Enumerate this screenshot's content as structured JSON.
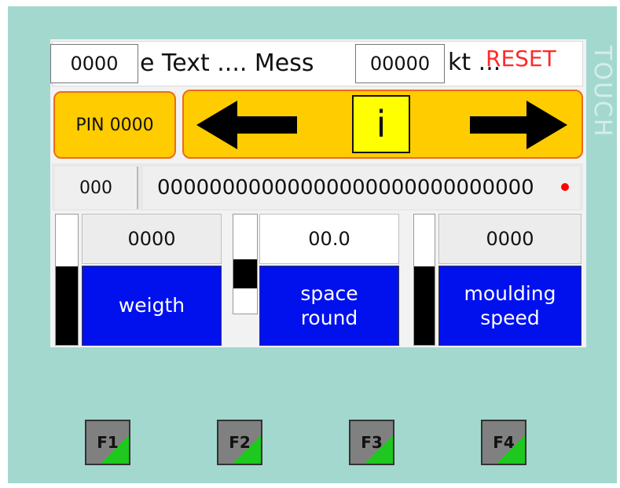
{
  "message_bar": {
    "counter_left": "0000",
    "scroll_text": "ge Text .... Mess",
    "counter_right": "00000",
    "scroll_text_tail": "kt ...",
    "reset_label": "RESET"
  },
  "nav": {
    "pin_label": "PIN 0000",
    "left_arrow_icon": "arrow-left-icon",
    "info_label": "i",
    "right_arrow_icon": "arrow-right-icon"
  },
  "status_row": {
    "code": "000",
    "long_value": "00000000000000000000000000000"
  },
  "channels": [
    {
      "value": "0000",
      "label_lines": [
        "weigth"
      ],
      "gauge_level": 0.6
    },
    {
      "value": "00.0",
      "label_lines": [
        "space",
        "round"
      ],
      "gauge_level": 0.3
    },
    {
      "value": "0000",
      "label_lines": [
        "moulding",
        "speed"
      ],
      "gauge_level": 0.6
    }
  ],
  "function_keys": [
    "F1",
    "F2",
    "F3",
    "F4"
  ],
  "colors": {
    "panel_bg": "#a3d8cf",
    "nav_yellow": "#ffcc00",
    "nav_border": "#f06a1a",
    "label_blue": "#0011ee",
    "reset_red": "#ff2a2a",
    "fkey_green": "#1ec81e"
  }
}
